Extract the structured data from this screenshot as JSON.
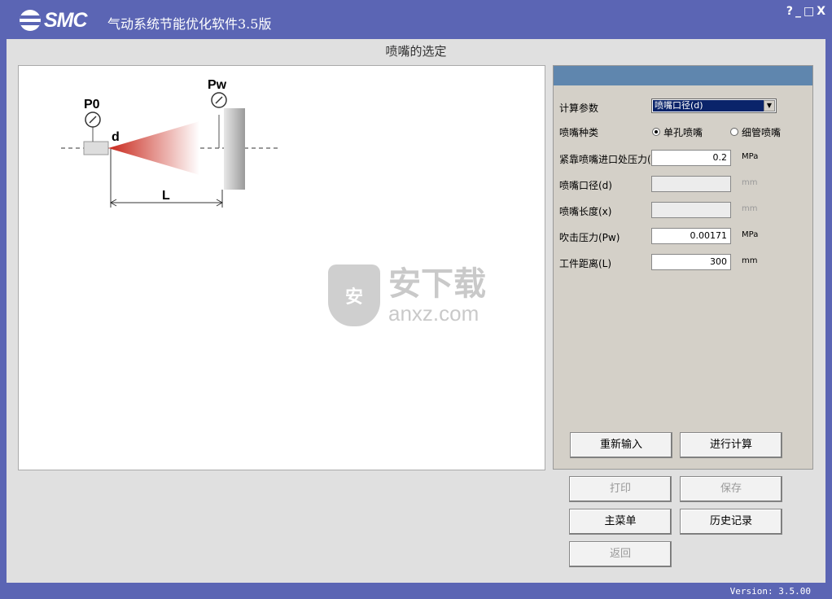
{
  "window": {
    "logo_text": "SMC",
    "app_title": "气动系统节能优化软件3.5版",
    "controls": [
      "?",
      "_",
      "□",
      "X"
    ]
  },
  "page_heading": "喷嘴的选定",
  "diagram": {
    "label_p0": "P0",
    "label_pw": "Pw",
    "label_d": "d",
    "label_l": "L"
  },
  "watermark": {
    "badge": "安",
    "cn": "安下载",
    "en": "anxz.com"
  },
  "panel": {
    "calc_param_label": "计算参数",
    "calc_param_value": "喷嘴口径(d)",
    "nozzle_type_label": "喷嘴种类",
    "nozzle_types": [
      {
        "label": "单孔喷嘴",
        "selected": true
      },
      {
        "label": "细管喷嘴",
        "selected": false
      }
    ],
    "fields": [
      {
        "label": "紧靠喷嘴进口处压力(",
        "value": "0.2",
        "unit": "MPa",
        "disabled": false
      },
      {
        "label": "喷嘴口径(d)",
        "value": "",
        "unit": "mm",
        "disabled": true
      },
      {
        "label": "喷嘴长度(x)",
        "value": "",
        "unit": "mm",
        "disabled": true
      },
      {
        "label": "吹击压力(Pw)",
        "value": "0.00171",
        "unit": "MPa",
        "disabled": false
      },
      {
        "label": "工件距离(L)",
        "value": "300",
        "unit": "mm",
        "disabled": false
      }
    ],
    "reset_button": "重新输入",
    "calc_button": "进行计算"
  },
  "buttons": {
    "print": "打印",
    "save": "保存",
    "main_menu": "主菜单",
    "history": "历史记录",
    "back": "返回"
  },
  "status": {
    "version": "Version: 3.5.00"
  }
}
